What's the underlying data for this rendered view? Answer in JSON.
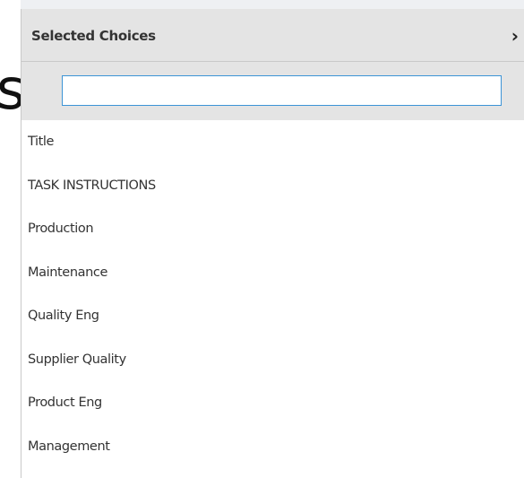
{
  "background": {
    "partial_text": "s"
  },
  "panel": {
    "title": "Selected Choices",
    "expand_icon": "chevron-right-icon",
    "expand_glyph": "›",
    "search": {
      "value": "",
      "placeholder": ""
    },
    "items": [
      {
        "label": "Title"
      },
      {
        "label": "TASK INSTRUCTIONS"
      },
      {
        "label": "Production"
      },
      {
        "label": "Maintenance"
      },
      {
        "label": "Quality Eng"
      },
      {
        "label": "Supplier Quality"
      },
      {
        "label": "Product Eng"
      },
      {
        "label": "Management"
      }
    ]
  },
  "colors": {
    "header_bg": "#e4e4e4",
    "input_border": "#3c94d6",
    "text": "#333333"
  }
}
